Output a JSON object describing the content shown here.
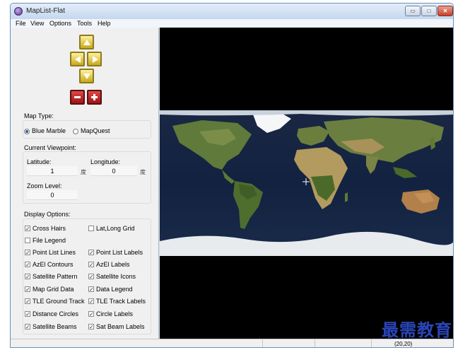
{
  "window": {
    "title": "MapList-Flat",
    "buttons": {
      "minimize": "▭",
      "maximize": "□",
      "close": "✕"
    }
  },
  "menubar": [
    "File",
    "View",
    "Options",
    "Tools",
    "Help"
  ],
  "navigation": {
    "icons": [
      "arrow-up-icon",
      "arrow-left-icon",
      "arrow-right-icon",
      "arrow-down-icon",
      "minus-icon",
      "plus-icon"
    ],
    "colors": {
      "pan": "#e2c43a",
      "zoom": "#b81c1c"
    }
  },
  "map_type": {
    "title": "Map Type:",
    "options": [
      {
        "label": "Blue Marble",
        "selected": true
      },
      {
        "label": "MapQuest",
        "selected": false
      }
    ]
  },
  "viewpoint": {
    "title": "Current Viewpoint:",
    "latitude_label": "Latitude:",
    "latitude_value": "1",
    "latitude_unit": "度",
    "longitude_label": "Longitude:",
    "longitude_value": "0",
    "longitude_unit": "度",
    "zoom_label": "Zoom Level:",
    "zoom_value": "0"
  },
  "display_options": {
    "title": "Display Options:",
    "items": [
      {
        "label": "Cross Hairs",
        "checked": true
      },
      {
        "label": "Lat,Long Grid",
        "checked": false
      },
      {
        "label": "File Legend",
        "checked": false
      },
      {
        "label": "Point List Lines",
        "checked": true
      },
      {
        "label": "Point List Labels",
        "checked": true
      },
      {
        "label": "AzEl Contours",
        "checked": true
      },
      {
        "label": "AzEl Labels",
        "checked": true
      },
      {
        "label": "Satellite Pattern",
        "checked": true
      },
      {
        "label": "Satellite Icons",
        "checked": true
      },
      {
        "label": "Map Grid Data",
        "checked": true
      },
      {
        "label": "Data Legend",
        "checked": true
      },
      {
        "label": "TLE Ground Track",
        "checked": true
      },
      {
        "label": "TLE Track Labels",
        "checked": true
      },
      {
        "label": "Distance Circles",
        "checked": true
      },
      {
        "label": "Circle Labels",
        "checked": true
      },
      {
        "label": "Satellite Beams",
        "checked": true
      },
      {
        "label": "Sat Beam Labels",
        "checked": true
      }
    ]
  },
  "map": {
    "crosshair": "+"
  },
  "statusbar": {
    "coords": "(20,20)"
  },
  "watermark": "最需教育"
}
